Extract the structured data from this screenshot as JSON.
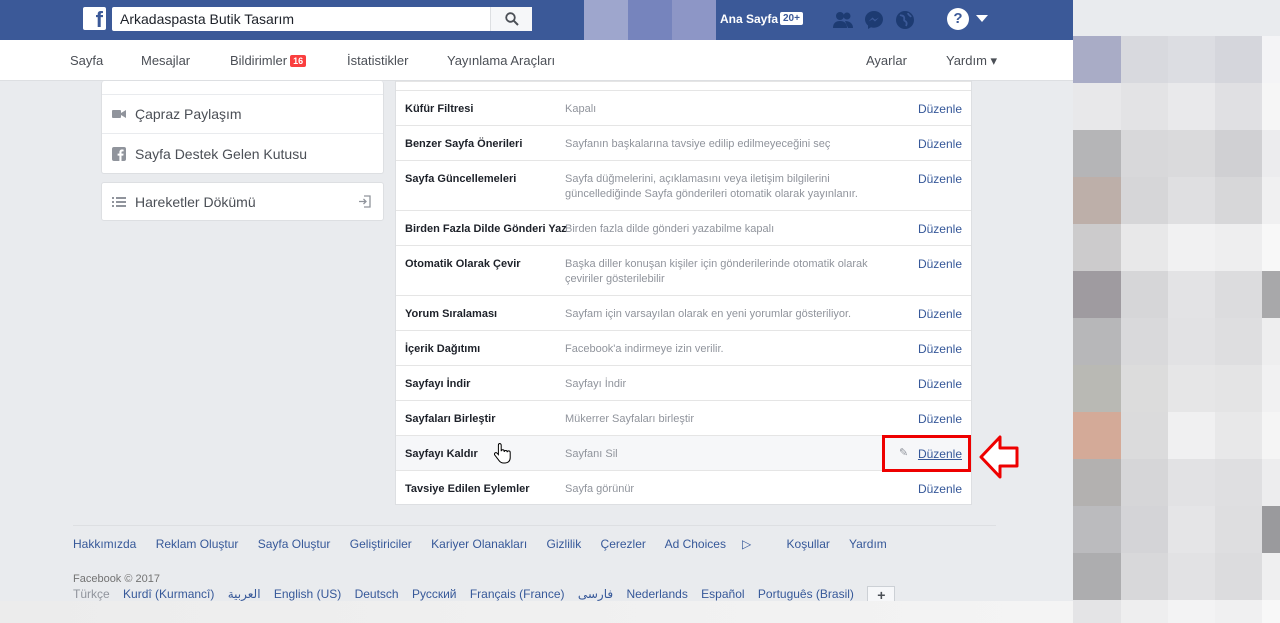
{
  "header": {
    "search_value": "Arkadaspasta Butik Tasarım",
    "home_label": "Ana Sayfa",
    "home_badge": "20+",
    "help_glyph": "?"
  },
  "page_nav": {
    "items": [
      "Sayfa",
      "Mesajlar",
      "Bildirimler",
      "İstatistikler",
      "Yayınlama Araçları"
    ],
    "notifications_badge": "16",
    "settings_label": "Ayarlar",
    "help_label": "Yardım ▾"
  },
  "sidebar": {
    "items": [
      "Çapraz Paylaşım",
      "Sayfa Destek Gelen Kutusu"
    ],
    "activity_log": "Hareketler Dökümü"
  },
  "settings": {
    "edit_label": "Düzenle",
    "rows": [
      {
        "label": "Küfür Filtresi",
        "value": "Kapalı"
      },
      {
        "label": "Benzer Sayfa Önerileri",
        "value": "Sayfanın başkalarına tavsiye edilip edilmeyeceğini seç"
      },
      {
        "label": "Sayfa Güncellemeleri",
        "value": "Sayfa düğmelerini, açıklamasını veya iletişim bilgilerini güncellediğinde Sayfa gönderileri otomatik olarak yayınlanır."
      },
      {
        "label": "Birden Fazla Dilde Gönderi Yaz",
        "value": "Birden fazla dilde gönderi yazabilme kapalı"
      },
      {
        "label": "Otomatik Olarak Çevir",
        "value": "Başka diller konuşan kişiler için gönderilerinde otomatik olarak çeviriler gösterilebilir"
      },
      {
        "label": "Yorum Sıralaması",
        "value": "Sayfam için varsayılan olarak en yeni yorumlar gösteriliyor."
      },
      {
        "label": "İçerik Dağıtımı",
        "value": "Facebook'a indirmeye izin verilir."
      },
      {
        "label": "Sayfayı İndir",
        "value": "Sayfayı İndir"
      },
      {
        "label": "Sayfaları Birleştir",
        "value": "Mükerrer Sayfaları birleştir"
      },
      {
        "label": "Sayfayı Kaldır",
        "value": "Sayfanı Sil"
      },
      {
        "label": "Tavsiye Edilen Eylemler",
        "value": "Sayfa görünür"
      }
    ]
  },
  "footer": {
    "links": [
      "Hakkımızda",
      "Reklam Oluştur",
      "Sayfa Oluştur",
      "Geliştiriciler",
      "Kariyer Olanakları",
      "Gizlilik",
      "Çerezler",
      "Ad Choices",
      "Koşullar",
      "Yardım"
    ],
    "copyright": "Facebook © 2017",
    "languages": [
      "Türkçe",
      "Kurdî (Kurmancî)",
      "العربية",
      "English (US)",
      "Deutsch",
      "Русский",
      "Français (France)",
      "فارسی",
      "Nederlands",
      "Español",
      "Português (Brasil)"
    ],
    "more_languages": "+"
  },
  "colors": {
    "brand": "#3b5998",
    "link": "#365899",
    "highlight_border": "#ee0000"
  }
}
